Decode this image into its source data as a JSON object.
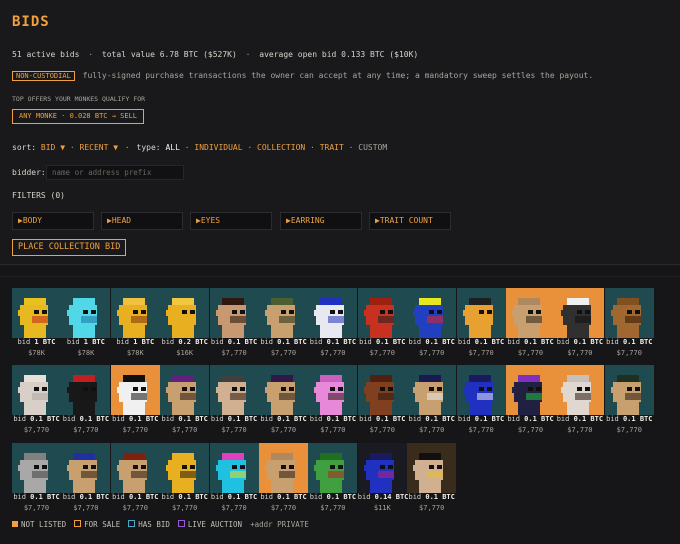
{
  "title": "BIDS",
  "summary": {
    "active": "51 active bids",
    "dot1": "·",
    "total": "total value 6.78 BTC ($527K)",
    "dot2": "·",
    "average": "average open bid 0.133 BTC ($10K)"
  },
  "non_custodial": {
    "badge": "NON-CUSTODIAL",
    "text": "fully-signed purchase transactions the owner can accept at any time; a mandatory sweep settles the payout."
  },
  "top_offers": {
    "heading": "TOP OFFERS YOUR MONKES QUALIFY FOR",
    "sell_button": "ANY MONKE · 0.028 BTC → SELL"
  },
  "sort": {
    "label": "sort:",
    "bid": "BID ▼",
    "dot1": "·",
    "recent": "RECENT ▼",
    "dot2": "·",
    "type_label": "type:",
    "types": [
      "ALL",
      "·",
      "INDIVIDUAL",
      "·",
      "COLLECTION",
      "·",
      "TRAIT",
      "·",
      "CUSTOM"
    ]
  },
  "bidder": {
    "label": "bidder:",
    "placeholder": "name or address prefix"
  },
  "filters": {
    "label": "FILTERS (0)",
    "items": [
      "▶BODY",
      "▶HEAD",
      "▶EYES",
      "▶EARRING",
      "▶TRAIT COUNT"
    ]
  },
  "collection_bid_button": "PLACE COLLECTION BID",
  "colors": {
    "accent": "#f0a040",
    "card_teal": "#1f4a50",
    "card_orange": "#e8913a",
    "card_brown": "#3a2c1c",
    "not_listed": "#f0a040",
    "for_sale": "#f0a040",
    "has_bid": "#4aa8c8",
    "live_auction": "#9a5ad8"
  },
  "rows": [
    [
      {
        "bid_prefix": "bid",
        "amount": "1 BTC",
        "usd": "$78K",
        "bg": "#1f4a50",
        "skin": "#e8b820",
        "hat": "#e8c020",
        "accent": "#c02020"
      },
      {
        "bid_prefix": "bid",
        "amount": "1 BTC",
        "usd": "$78K",
        "bg": "#1f4a50",
        "skin": "#50d8e8",
        "hat": "#50d8e8",
        "accent": "#2070a0"
      },
      {
        "bid_prefix": "bid",
        "amount": "1 BTC",
        "usd": "$78K",
        "bg": "#1f4a50",
        "skin": "#e8b020",
        "hat": "#f0c040",
        "accent": "#803010"
      },
      {
        "bid_prefix": "bid",
        "amount": "0.2 BTC",
        "usd": "$16K",
        "bg": "#1f4a50",
        "skin": "#e8b020",
        "hat": "#f0c840",
        "accent": "#e8b020"
      },
      {
        "bid_prefix": "bid",
        "amount": "0.1 BTC",
        "usd": "$7,770",
        "bg": "#1f4a50",
        "skin": "#c89870",
        "hat": "#301810",
        "accent": "#201008"
      },
      {
        "bid_prefix": "bid",
        "amount": "0.1 BTC",
        "usd": "$7,770",
        "bg": "#1f4a50",
        "skin": "#c8a070",
        "hat": "#4a6030",
        "accent": "#203018"
      },
      {
        "bid_prefix": "bid",
        "amount": "0.1 BTC",
        "usd": "$7,770",
        "bg": "#1f4a50",
        "skin": "#e8e8f0",
        "hat": "#2030c0",
        "accent": "#2030c0"
      },
      {
        "bid_prefix": "bid",
        "amount": "0.1 BTC",
        "usd": "$7,770",
        "bg": "#1f4a50",
        "skin": "#c83020",
        "hat": "#a02010",
        "accent": "#202020"
      },
      {
        "bid_prefix": "bid",
        "amount": "0.1 BTC",
        "usd": "$7,770",
        "bg": "#1f4a50",
        "skin": "#2040c0",
        "hat": "#e8e820",
        "accent": "#e82020"
      },
      {
        "bid_prefix": "bid",
        "amount": "0.1 BTC",
        "usd": "$7,770",
        "bg": "#1f4a50",
        "skin": "#e8a030",
        "hat": "#202020",
        "accent": "#e8a030"
      },
      {
        "bid_prefix": "bid",
        "amount": "0.1 BTC",
        "usd": "$7,770",
        "bg": "#e8913a",
        "skin": "#c8a070",
        "hat": "#b08860",
        "accent": "#302018"
      },
      {
        "bid_prefix": "bid",
        "amount": "0.1 BTC",
        "usd": "$7,770",
        "bg": "#e8913a",
        "skin": "#303030",
        "hat": "#f0f0f0",
        "accent": "#101010"
      },
      {
        "bid_prefix": "bid",
        "amount": "0.1 BTC",
        "usd": "$7,770",
        "bg": "#1f4a50",
        "skin": "#a06830",
        "hat": "#805020",
        "accent": "#301808"
      }
    ],
    [
      {
        "bid_prefix": "bid",
        "amount": "0.1 BTC",
        "usd": "$7,770",
        "bg": "#1f4a50",
        "skin": "#d8d0c8",
        "hat": "#e8e0d8",
        "accent": "#b0a8a0"
      },
      {
        "bid_prefix": "bid",
        "amount": "0.1 BTC",
        "usd": "$7,770",
        "bg": "#1f4a50",
        "skin": "#181818",
        "hat": "#c02020",
        "accent": "#181818"
      },
      {
        "bid_prefix": "bid",
        "amount": "0.1 BTC",
        "usd": "$7,770",
        "bg": "#e8913a",
        "skin": "#f0f0f0",
        "hat": "#101010",
        "accent": "#101010"
      },
      {
        "bid_prefix": "bid",
        "amount": "0.1 BTC",
        "usd": "$7,770",
        "bg": "#1f4a50",
        "skin": "#c8a070",
        "hat": "#602080",
        "accent": "#2a1a10"
      },
      {
        "bid_prefix": "bid",
        "amount": "0.1 BTC",
        "usd": "$7,770",
        "bg": "#1f4a50",
        "skin": "#d0b090",
        "hat": "#404040",
        "accent": "#2a1a10"
      },
      {
        "bid_prefix": "bid",
        "amount": "0.1 BTC",
        "usd": "$7,770",
        "bg": "#1f4a50",
        "skin": "#c8a070",
        "hat": "#301848",
        "accent": "#2a1a10"
      },
      {
        "bid_prefix": "bid",
        "amount": "0.1 BTC",
        "usd": "$7,770",
        "bg": "#1f4a50",
        "skin": "#e888d8",
        "hat": "#c860c0",
        "accent": "#2a1a10"
      },
      {
        "bid_prefix": "bid",
        "amount": "0.1 BTC",
        "usd": "$7,770",
        "bg": "#1f4a50",
        "skin": "#804020",
        "hat": "#502010",
        "accent": "#2a1a10"
      },
      {
        "bid_prefix": "bid",
        "amount": "0.1 BTC",
        "usd": "$7,770",
        "bg": "#1f4a50",
        "skin": "#c8a070",
        "hat": "#1a1a50",
        "accent": "#e8e8f0"
      },
      {
        "bid_prefix": "bid",
        "amount": "0.1 BTC",
        "usd": "$7,770",
        "bg": "#1f4a50",
        "skin": "#2030c0",
        "hat": "#1a1a60",
        "accent": "#e8e8f0"
      },
      {
        "bid_prefix": "bid",
        "amount": "0.1 BTC",
        "usd": "$7,770",
        "bg": "#e8913a",
        "skin": "#202040",
        "hat": "#8030c0",
        "accent": "#20c040"
      },
      {
        "bid_prefix": "bid",
        "amount": "0.1 BTC",
        "usd": "$7,770",
        "bg": "#e8913a",
        "skin": "#e0d8d0",
        "hat": "#c8c0b8",
        "accent": "#2a1a10"
      },
      {
        "bid_prefix": "bid",
        "amount": "0.1 BTC",
        "usd": "$7,770",
        "bg": "#1f4a50",
        "skin": "#c8a070",
        "hat": "#203020",
        "accent": "#2a1a10"
      }
    ],
    [
      {
        "bid_prefix": "bid",
        "amount": "0.1 BTC",
        "usd": "$7,770",
        "bg": "#1f4a50",
        "skin": "#a8a8a8",
        "hat": "#808080",
        "accent": "#404040"
      },
      {
        "bid_prefix": "bid",
        "amount": "0.1 BTC",
        "usd": "$7,770",
        "bg": "#1f4a50",
        "skin": "#c8a070",
        "hat": "#2030a0",
        "accent": "#2a1a10"
      },
      {
        "bid_prefix": "bid",
        "amount": "0.1 BTC",
        "usd": "$7,770",
        "bg": "#1f4a50",
        "skin": "#c8a070",
        "hat": "#802010",
        "accent": "#2a1a10"
      },
      {
        "bid_prefix": "bid",
        "amount": "0.1 BTC",
        "usd": "$7,770",
        "bg": "#1f4a50",
        "skin": "#e8b020",
        "hat": "#e8b020",
        "accent": "#2a1a10"
      },
      {
        "bid_prefix": "bid",
        "amount": "0.1 BTC",
        "usd": "$7,770",
        "bg": "#1f4a50",
        "skin": "#20c0e0",
        "hat": "#e040c0",
        "accent": "#e8e020"
      },
      {
        "bid_prefix": "bid",
        "amount": "0.1 BTC",
        "usd": "$7,770",
        "bg": "#e8913a",
        "skin": "#c8a070",
        "hat": "#b08860",
        "accent": "#2a1a10"
      },
      {
        "bid_prefix": "bid",
        "amount": "0.1 BTC",
        "usd": "$7,770",
        "bg": "#1f4a50",
        "skin": "#40a040",
        "hat": "#207020",
        "accent": "#c02020"
      },
      {
        "bid_prefix": "bid",
        "amount": "0.14 BTC",
        "usd": "$11K",
        "bg": "#1a1a22",
        "skin": "#2030c0",
        "hat": "#1a1a60",
        "accent": "#c02080"
      },
      {
        "bid_prefix": "bid",
        "amount": "0.1 BTC",
        "usd": "$7,770",
        "bg": "#3a2c1c",
        "skin": "#d0b090",
        "hat": "#101010",
        "accent": "#e8c020"
      }
    ]
  ],
  "legend": {
    "not_listed": "NOT LISTED",
    "for_sale": "FOR SALE",
    "has_bid": "HAS BID",
    "live_auction": "LIVE AUCTION",
    "private": "+addr PRIVATE"
  }
}
